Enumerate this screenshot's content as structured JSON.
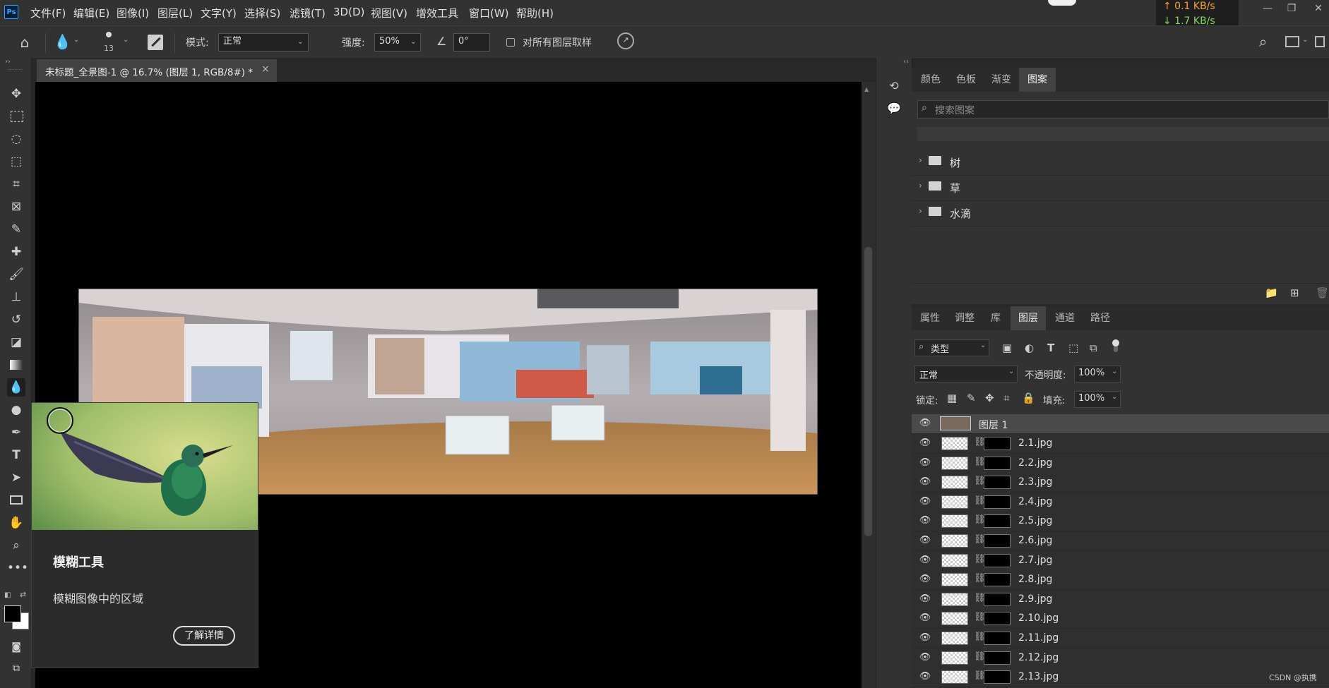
{
  "app": {
    "logo_text": "Ps"
  },
  "menu": [
    "文件(F)",
    "编辑(E)",
    "图像(I)",
    "图层(L)",
    "文字(Y)",
    "选择(S)",
    "滤镜(T)",
    "3D(D)",
    "视图(V)",
    "增效工具",
    "窗口(W)",
    "帮助(H)"
  ],
  "netspeed": {
    "up": "↑ 0.1 KB/s",
    "down": "↓ 1.7 KB/s"
  },
  "options": {
    "brush_size": "13",
    "mode_label": "模式:",
    "mode_value": "正常",
    "strength_label": "强度:",
    "strength_value": "50%",
    "angle_value": "0°",
    "sample_all_label": "对所有图层取样"
  },
  "document": {
    "tab_title": "未标题_全景图-1 @ 16.7% (图层 1, RGB/8#) *",
    "close_symbol": "×"
  },
  "tooltip": {
    "title": "模糊工具",
    "description": "模糊图像中的区域",
    "learn_more": "了解详情"
  },
  "pattern_panel": {
    "tabs": [
      "颜色",
      "色板",
      "渐变",
      "图案"
    ],
    "selected_tab": "图案",
    "search_placeholder": "搜索图案",
    "folders": [
      "树",
      "草",
      "水滴"
    ]
  },
  "layers_panel": {
    "tabs": [
      "属性",
      "调整",
      "库",
      "图层",
      "通道",
      "路径"
    ],
    "selected_tab": "图层",
    "filter_value": "类型",
    "blend_mode": "正常",
    "opacity_label": "不透明度:",
    "opacity_value": "100%",
    "lock_label": "锁定:",
    "fill_label": "填充:",
    "fill_value": "100%",
    "top_layer": "图层 1",
    "layers": [
      "2.1.jpg",
      "2.2.jpg",
      "2.3.jpg",
      "2.4.jpg",
      "2.5.jpg",
      "2.6.jpg",
      "2.7.jpg",
      "2.8.jpg",
      "2.9.jpg",
      "2.10.jpg",
      "2.11.jpg",
      "2.12.jpg",
      "2.13.jpg"
    ]
  },
  "watermark": "CSDN @执携"
}
